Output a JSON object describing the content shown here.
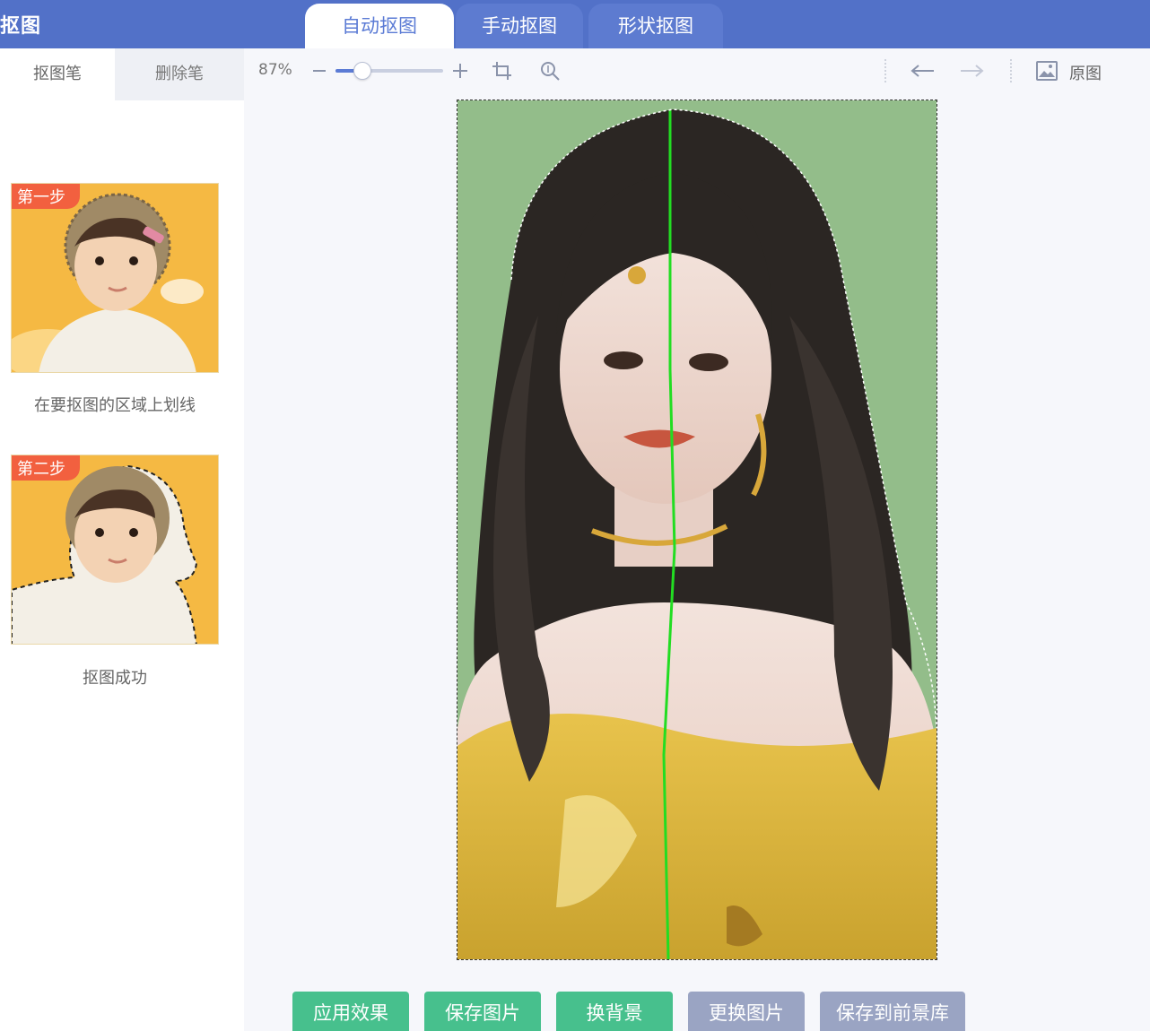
{
  "app": {
    "title": "抠图"
  },
  "tabs": [
    {
      "label": "自动抠图",
      "active": true
    },
    {
      "label": "手动抠图",
      "active": false
    },
    {
      "label": "形状抠图",
      "active": false
    }
  ],
  "left_panel": {
    "tabs": [
      {
        "label": "抠图笔",
        "active": true
      },
      {
        "label": "删除笔",
        "active": false
      }
    ],
    "steps": [
      {
        "badge": "第一步",
        "caption": "在要抠图的区域上划线"
      },
      {
        "badge": "第二步",
        "caption": "抠图成功"
      }
    ]
  },
  "toolbar": {
    "zoom": "87%",
    "zoom_level": 0.25,
    "zoom_out_icon": "minus-icon",
    "zoom_in_icon": "plus-icon",
    "crop_icon": "crop-icon",
    "zoom_fit_icon": "magnifier-icon",
    "undo_icon": "arrow-left-icon",
    "redo_icon": "arrow-right-icon",
    "original_icon": "image-icon",
    "original_label": "原图"
  },
  "actions": [
    {
      "label": "应用效果",
      "style": "green"
    },
    {
      "label": "保存图片",
      "style": "green"
    },
    {
      "label": "换背景",
      "style": "green"
    },
    {
      "label": "更换图片",
      "style": "gray"
    },
    {
      "label": "保存到前景库",
      "style": "gray"
    }
  ],
  "colors": {
    "header": "#5271c8",
    "accent": "#5b7bd5",
    "button_green": "#47c08d",
    "button_gray": "#9aa4c3",
    "stroke_line": "#22dd22",
    "photo_background": "#93bd8a"
  }
}
